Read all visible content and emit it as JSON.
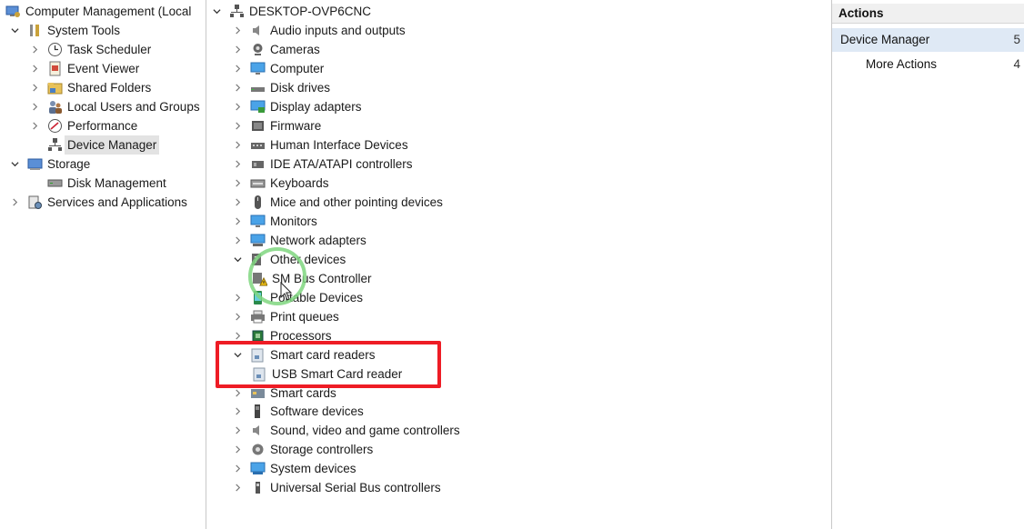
{
  "left_tree": {
    "root": "Computer Management (Local",
    "system_tools": "System Tools",
    "task_scheduler": "Task Scheduler",
    "event_viewer": "Event Viewer",
    "shared_folders": "Shared Folders",
    "local_users_groups": "Local Users and Groups",
    "performance": "Performance",
    "device_manager": "Device Manager",
    "storage": "Storage",
    "disk_management": "Disk Management",
    "services_apps": "Services and Applications"
  },
  "device_tree": {
    "computer_name": "DESKTOP-OVP6CNC",
    "categories": [
      "Audio inputs and outputs",
      "Cameras",
      "Computer",
      "Disk drives",
      "Display adapters",
      "Firmware",
      "Human Interface Devices",
      "IDE ATA/ATAPI controllers",
      "Keyboards",
      "Mice and other pointing devices",
      "Monitors",
      "Network adapters",
      "Other devices",
      "SM Bus Controller",
      "Portable Devices",
      "Print queues",
      "Processors",
      "Smart card readers",
      "USB Smart Card reader",
      "Smart cards",
      "Software devices",
      "Sound, video and game controllers",
      "Storage controllers",
      "System devices",
      "Universal Serial Bus controllers"
    ]
  },
  "actions": {
    "header": "Actions",
    "device_manager": "Device Manager",
    "device_manager_side": "5",
    "more_actions": "More Actions",
    "more_actions_side": "4"
  },
  "colors": {
    "highlight_box": "#ee1c25",
    "click_ring": "#7fd67f",
    "selection": "#e3e3e3",
    "actions_selected": "#dfe9f5"
  }
}
